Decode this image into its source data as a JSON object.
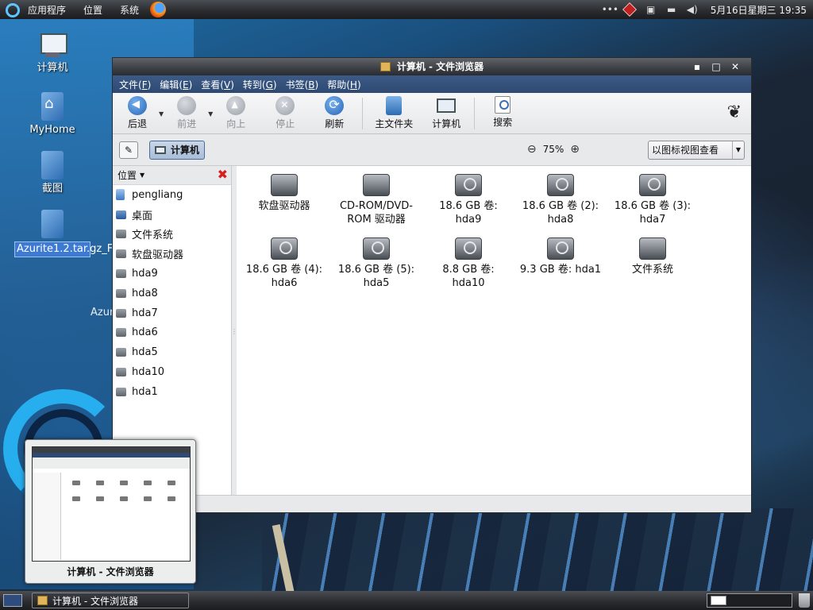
{
  "top_panel": {
    "menus": [
      "应用程序",
      "位置",
      "系统"
    ],
    "clock": "5月16日星期三 19:35"
  },
  "desktop_icons": [
    {
      "label": "计算机",
      "icon": "computer-icon"
    },
    {
      "label": "MyHome",
      "icon": "home-folder-icon"
    },
    {
      "label": "截图",
      "icon": "folder-icon"
    },
    {
      "label": "Azurite1.2.tar.gz_FILES",
      "icon": "folder-icon"
    }
  ],
  "desktop_partial_text": "Azur",
  "window": {
    "title": "计算机 - 文件浏览器",
    "menu": [
      {
        "label": "文件",
        "key": "F"
      },
      {
        "label": "编辑",
        "key": "E"
      },
      {
        "label": "查看",
        "key": "V"
      },
      {
        "label": "转到",
        "key": "G"
      },
      {
        "label": "书签",
        "key": "B"
      },
      {
        "label": "帮助",
        "key": "H"
      }
    ],
    "toolbar": {
      "back": "后退",
      "forward": "前进",
      "up": "向上",
      "stop": "停止",
      "refresh": "刷新",
      "home": "主文件夹",
      "computer": "计算机",
      "search": "搜索"
    },
    "location": {
      "crumb": "计算机",
      "zoom": "75%",
      "view_mode": "以图标视图查看"
    },
    "sidebar": {
      "header": "位置",
      "items": [
        "pengliang",
        "桌面",
        "文件系统",
        "软盘驱动器",
        "hda9",
        "hda8",
        "hda7",
        "hda6",
        "hda5",
        "hda10",
        "hda1"
      ]
    },
    "files": [
      {
        "line1": "软盘驱动器",
        "line2": ""
      },
      {
        "line1": "CD-ROM/DVD-",
        "line2": "ROM 驱动器"
      },
      {
        "line1": "18.6 GB 卷:",
        "line2": "hda9"
      },
      {
        "line1": "18.6 GB 卷 (2):",
        "line2": "hda8"
      },
      {
        "line1": "18.6 GB 卷 (3):",
        "line2": "hda7"
      },
      {
        "line1": "18.6 GB 卷 (4):",
        "line2": "hda6"
      },
      {
        "line1": "18.6 GB 卷 (5):",
        "line2": "hda5"
      },
      {
        "line1": "8.8 GB 卷:",
        "line2": "hda10"
      },
      {
        "line1": "9.3 GB 卷: hda1",
        "line2": ""
      },
      {
        "line1": "文件系统",
        "line2": ""
      }
    ]
  },
  "preview": {
    "title": "计算机 - 文件浏览器"
  },
  "taskbar": {
    "task_title": "计算机 - 文件浏览器"
  }
}
